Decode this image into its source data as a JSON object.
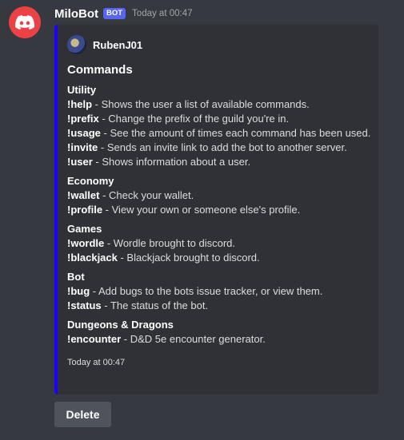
{
  "message": {
    "author": "MiloBot",
    "bot_tag": "BOT",
    "timestamp": "Today at 00:47",
    "avatar_icon": "discord-logo-icon",
    "avatar_color": "#ed4245"
  },
  "embed": {
    "accent_color": "#1d00ff",
    "author_name": "RubenJ01",
    "title": "Commands",
    "sections": [
      {
        "title": "Utility",
        "commands": [
          {
            "name": "!help",
            "desc": " - Shows the user a list of available commands."
          },
          {
            "name": "!prefix",
            "desc": " - Change the prefix of the guild you're in."
          },
          {
            "name": "!usage",
            "desc": " - See the amount of times each command has been used."
          },
          {
            "name": "!invite",
            "desc": " - Sends an invite link to add the bot to another server."
          },
          {
            "name": "!user",
            "desc": " - Shows information about a user."
          }
        ]
      },
      {
        "title": "Economy",
        "commands": [
          {
            "name": "!wallet",
            "desc": " - Check your wallet."
          },
          {
            "name": "!profile",
            "desc": " - View your own or someone else's profile."
          }
        ]
      },
      {
        "title": "Games",
        "commands": [
          {
            "name": "!wordle",
            "desc": " - Wordle brought to discord."
          },
          {
            "name": "!blackjack",
            "desc": " - Blackjack brought to discord."
          }
        ]
      },
      {
        "title": "Bot",
        "commands": [
          {
            "name": "!bug",
            "desc": " - Add bugs to the bots issue tracker, or view them."
          },
          {
            "name": "!status",
            "desc": " - The status of the bot."
          }
        ]
      },
      {
        "title": "Dungeons & Dragons",
        "commands": [
          {
            "name": "!encounter",
            "desc": " - D&D 5e encounter generator."
          }
        ]
      }
    ],
    "footer": "Today at 00:47"
  },
  "actions": {
    "delete_label": "Delete"
  }
}
